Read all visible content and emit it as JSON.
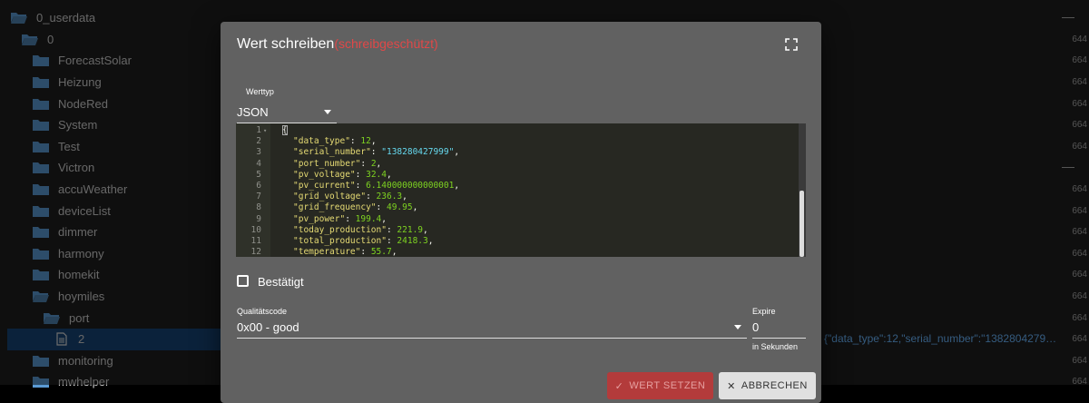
{
  "tree": {
    "items": [
      {
        "label": "0_userdata",
        "icon": "folder-open-icon",
        "perm": ""
      },
      {
        "label": "0",
        "icon": "folder-open-icon",
        "perm": "644"
      },
      {
        "label": "ForecastSolar",
        "icon": "folder-icon",
        "perm": "664"
      },
      {
        "label": "Heizung",
        "icon": "folder-icon",
        "perm": "664"
      },
      {
        "label": "NodeRed",
        "icon": "folder-icon",
        "perm": "664"
      },
      {
        "label": "System",
        "icon": "folder-icon",
        "perm": "664"
      },
      {
        "label": "Test",
        "icon": "folder-icon",
        "perm": "664"
      },
      {
        "label": "Victron",
        "icon": "folder-icon",
        "perm": ""
      },
      {
        "label": "accuWeather",
        "icon": "folder-icon",
        "perm": "664"
      },
      {
        "label": "deviceList",
        "icon": "folder-icon",
        "perm": "664"
      },
      {
        "label": "dimmer",
        "icon": "folder-icon",
        "perm": "664"
      },
      {
        "label": "harmony",
        "icon": "folder-icon",
        "perm": "664"
      },
      {
        "label": "homekit",
        "icon": "folder-icon",
        "perm": "664"
      },
      {
        "label": "hoymiles",
        "icon": "folder-open-icon",
        "perm": "664"
      },
      {
        "label": "port",
        "icon": "folder-open-icon",
        "perm": "664"
      },
      {
        "label": "2",
        "icon": "file-icon",
        "perm": "664"
      },
      {
        "label": "monitoring",
        "icon": "folder-icon",
        "perm": "664"
      },
      {
        "label": "mwhelper",
        "icon": "folder-icon",
        "perm": "664"
      }
    ],
    "selected_value_preview": "{\"data_type\":12,\"serial_number\":\"138280427999\",..."
  },
  "dialog": {
    "title": "Wert schreiben",
    "readonly_note": "(schreibgeschützt)",
    "type_label": "Werttyp",
    "type_value": "JSON",
    "editor_lines": [
      {
        "n": "1",
        "code": "{"
      },
      {
        "n": "2",
        "key": "\"data_type\"",
        "val": "12",
        "kind": "num"
      },
      {
        "n": "3",
        "key": "\"serial_number\"",
        "val": "\"138280427999\"",
        "kind": "str"
      },
      {
        "n": "4",
        "key": "\"port_number\"",
        "val": "2",
        "kind": "num"
      },
      {
        "n": "5",
        "key": "\"pv_voltage\"",
        "val": "32.4",
        "kind": "num"
      },
      {
        "n": "6",
        "key": "\"pv_current\"",
        "val": "6.140000000000001",
        "kind": "num"
      },
      {
        "n": "7",
        "key": "\"grid_voltage\"",
        "val": "236.3",
        "kind": "num"
      },
      {
        "n": "8",
        "key": "\"grid_frequency\"",
        "val": "49.95",
        "kind": "num"
      },
      {
        "n": "9",
        "key": "\"pv_power\"",
        "val": "199.4",
        "kind": "num"
      },
      {
        "n": "10",
        "key": "\"today_production\"",
        "val": "221.9",
        "kind": "num"
      },
      {
        "n": "11",
        "key": "\"total_production\"",
        "val": "2418.3",
        "kind": "num"
      },
      {
        "n": "12",
        "key": "\"temperature\"",
        "val": "55.7",
        "kind": "num"
      }
    ],
    "ack_label": "Bestätigt",
    "quality_label": "Qualitätscode",
    "quality_value": "0x00 - good",
    "expire_label": "Expire",
    "expire_value": "0",
    "expire_helper": "in Sekunden",
    "set_button": "WERT SETZEN",
    "cancel_button": "ABBRECHEN"
  },
  "colors": {
    "accent_red": "#b33b3b",
    "selected_row": "#164477",
    "folder": "#5b9bd5"
  }
}
